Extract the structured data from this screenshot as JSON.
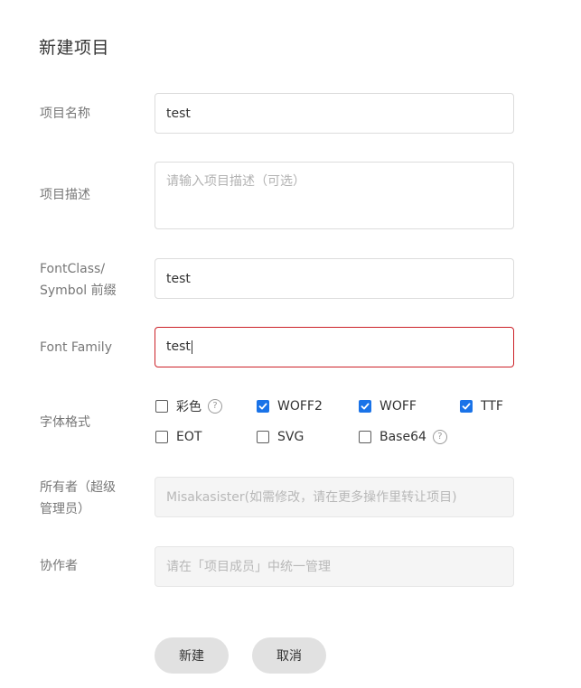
{
  "dialog": {
    "title": "新建项目"
  },
  "form": {
    "name": {
      "label": "项目名称",
      "value": "test"
    },
    "description": {
      "label": "项目描述",
      "value": "",
      "placeholder": "请输入项目描述（可选）"
    },
    "prefix": {
      "label_line1": "FontClass/",
      "label_line2": "Symbol 前缀",
      "value": "test"
    },
    "font_family": {
      "label": "Font Family",
      "value": "test"
    },
    "formats": {
      "label": "字体格式",
      "options": [
        {
          "label": "彩色",
          "checked": false,
          "has_help": true
        },
        {
          "label": "WOFF2",
          "checked": true
        },
        {
          "label": "WOFF",
          "checked": true
        },
        {
          "label": "TTF",
          "checked": true
        },
        {
          "label": "EOT",
          "checked": false
        },
        {
          "label": "SVG",
          "checked": false
        },
        {
          "label": "Base64",
          "checked": false,
          "has_help": true
        }
      ]
    },
    "owner": {
      "label_line1": "所有者（超级",
      "label_line2": "管理员）",
      "placeholder": "Misakasister(如需修改，请在更多操作里转让项目)"
    },
    "collaborators": {
      "label": "协作者",
      "placeholder": "请在「项目成员」中统一管理"
    }
  },
  "actions": {
    "create_label": "新建",
    "cancel_label": "取消"
  },
  "icons": {
    "help": "question-circle-icon",
    "check": "checkmark-icon"
  },
  "colors": {
    "accent": "#1a73e8",
    "error_border": "#cc2128",
    "button_bg": "#e1e1e1"
  }
}
